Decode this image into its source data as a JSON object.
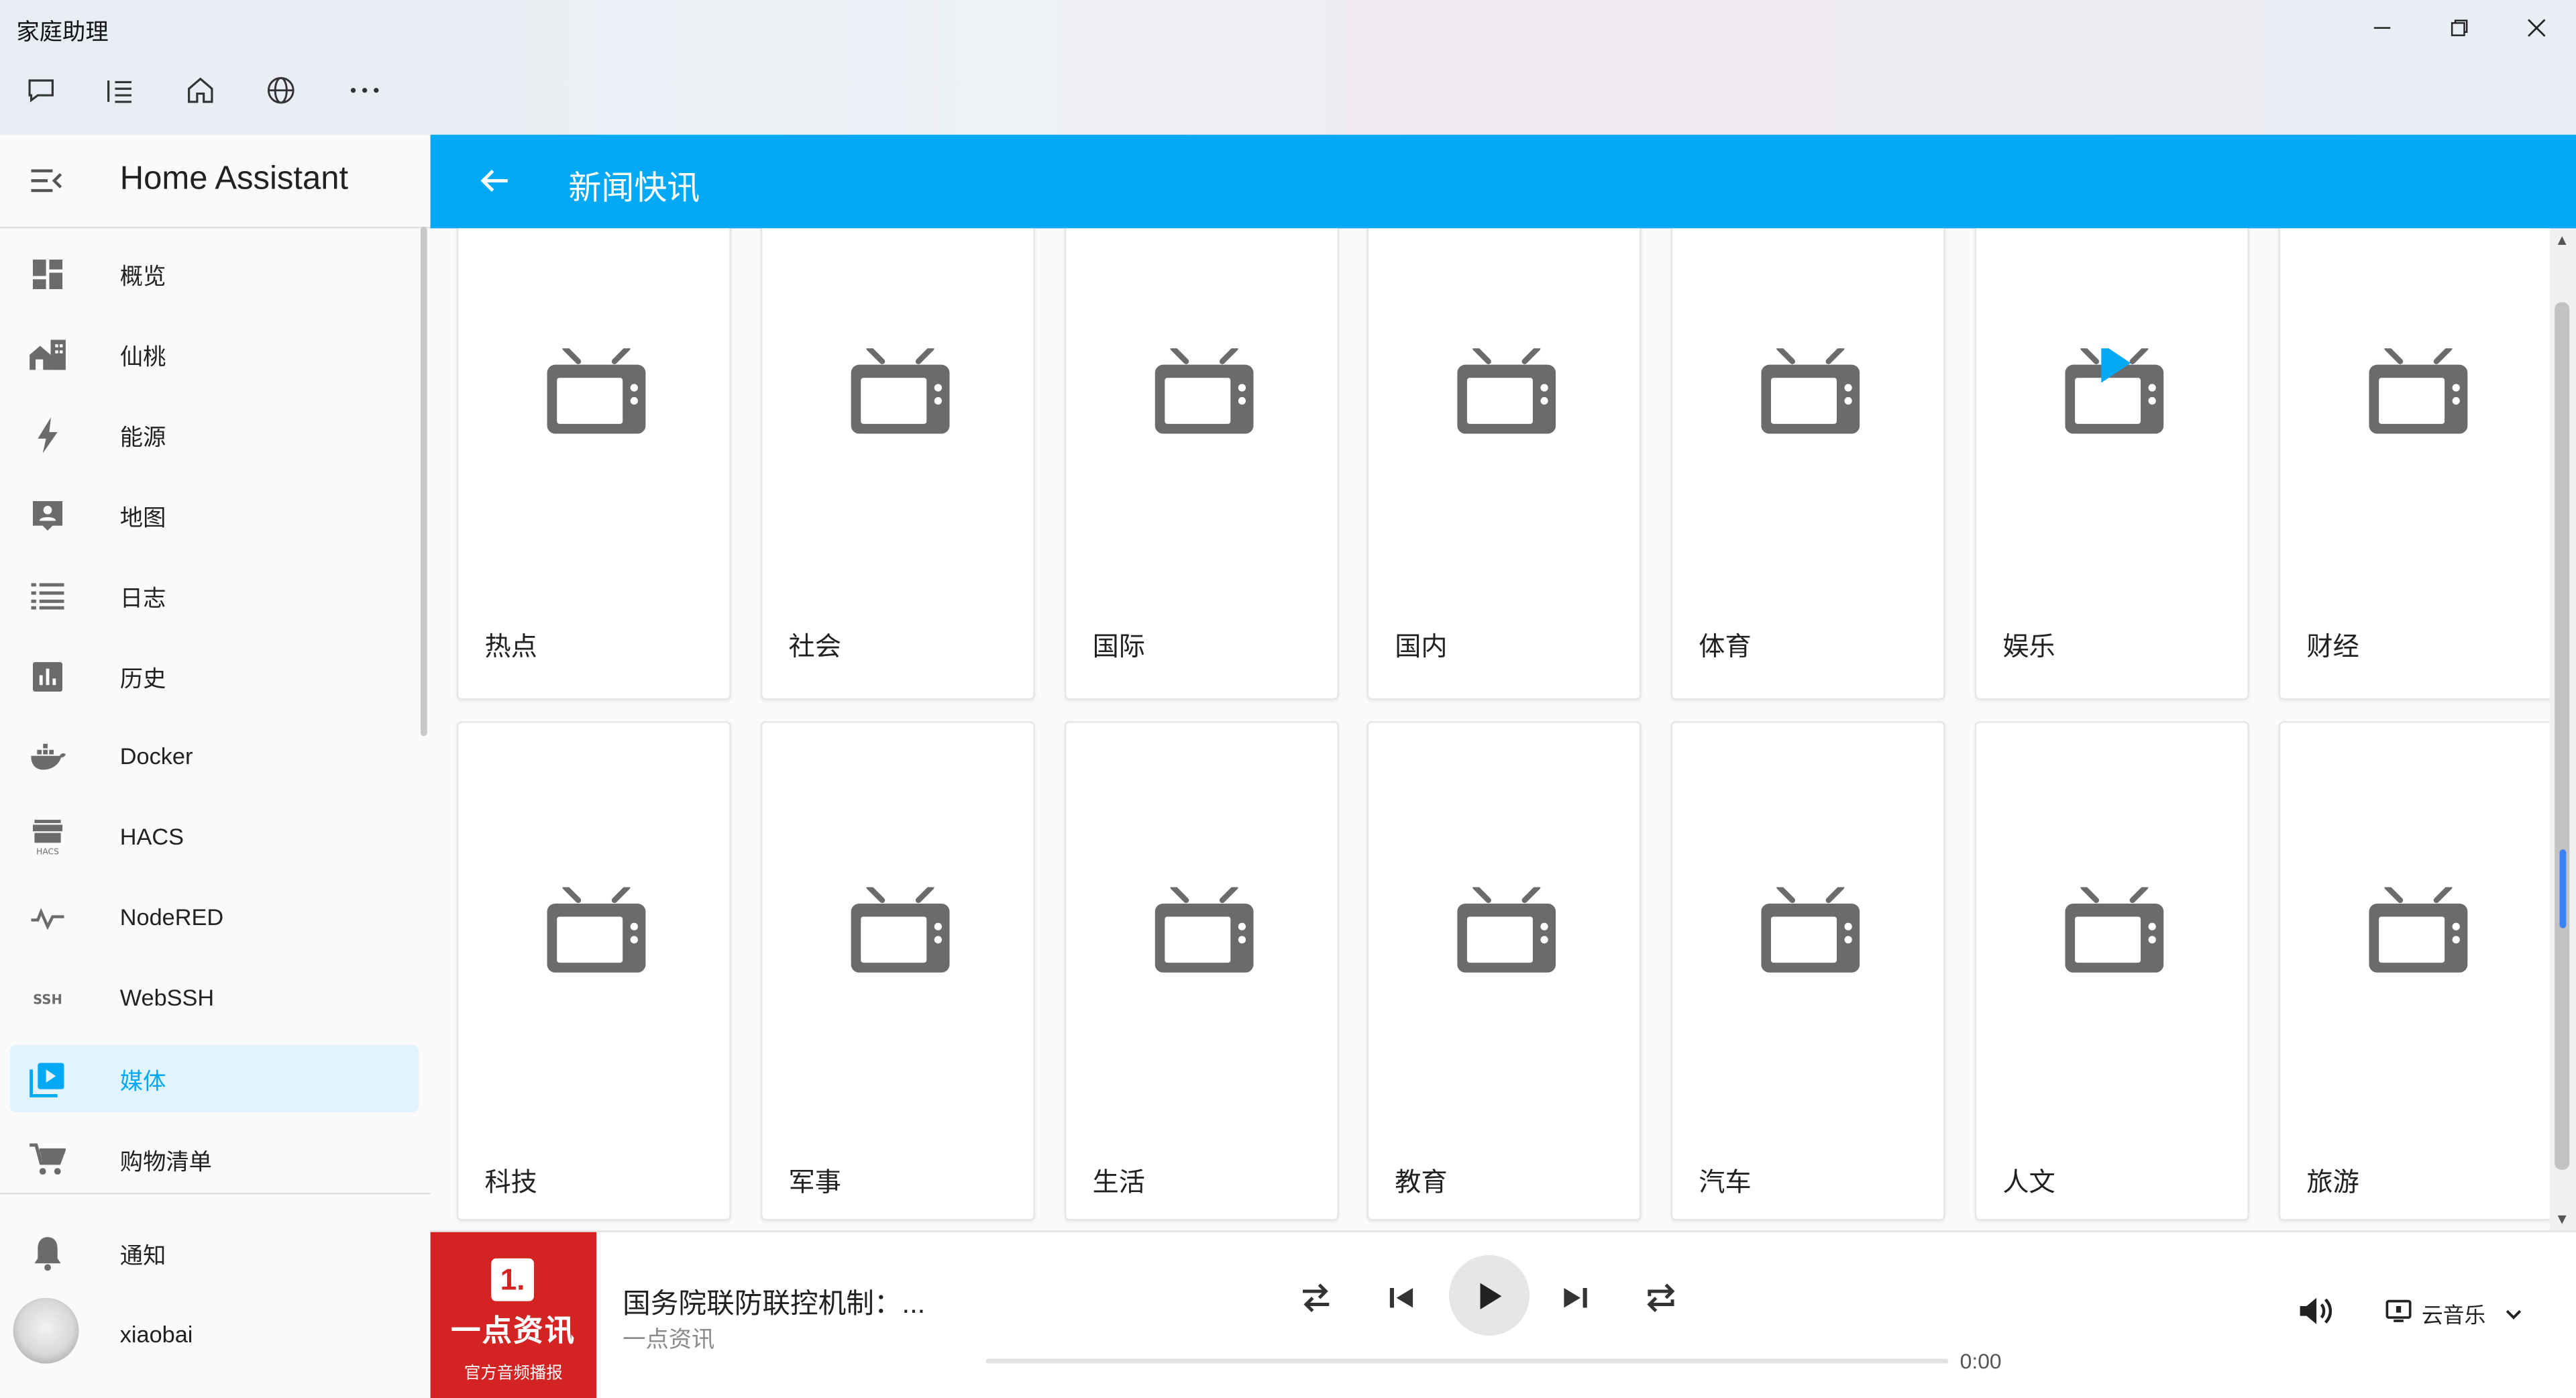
{
  "window": {
    "title": "家庭助理"
  },
  "sidebar": {
    "title": "Home Assistant",
    "items": [
      {
        "label": "概览",
        "icon": "dashboard-icon"
      },
      {
        "label": "仙桃",
        "icon": "home-city-icon"
      },
      {
        "label": "能源",
        "icon": "lightning-icon"
      },
      {
        "label": "地图",
        "icon": "map-person-icon"
      },
      {
        "label": "日志",
        "icon": "logbook-list-icon"
      },
      {
        "label": "历史",
        "icon": "chart-box-icon"
      },
      {
        "label": "Docker",
        "icon": "docker-whale-icon"
      },
      {
        "label": "HACS",
        "icon": "hacs-store-icon"
      },
      {
        "label": "NodeRED",
        "icon": "nodered-icon"
      },
      {
        "label": "WebSSH",
        "icon": "ssh-icon"
      },
      {
        "label": "媒体",
        "icon": "media-play-box-icon",
        "active": true
      },
      {
        "label": "购物清单",
        "icon": "cart-icon"
      }
    ],
    "notifications": "通知",
    "user": "xiaobai"
  },
  "header": {
    "title": "新闻快讯"
  },
  "categories": [
    "热点",
    "社会",
    "国际",
    "国内",
    "体育",
    "娱乐",
    "财经",
    "科技",
    "军事",
    "生活",
    "教育",
    "汽车",
    "人文",
    "旅游"
  ],
  "player": {
    "cover_badge": "1.",
    "cover_big": "一点资讯",
    "cover_small": "官方音频播报",
    "track_title": "国务院联防联控机制：...",
    "track_subtitle": "一点资讯",
    "time": "0:00",
    "source": "云音乐"
  },
  "colors": {
    "accent": "#03a9f4",
    "active_bg": "#e1f3fd",
    "cover_red": "#d32323"
  }
}
